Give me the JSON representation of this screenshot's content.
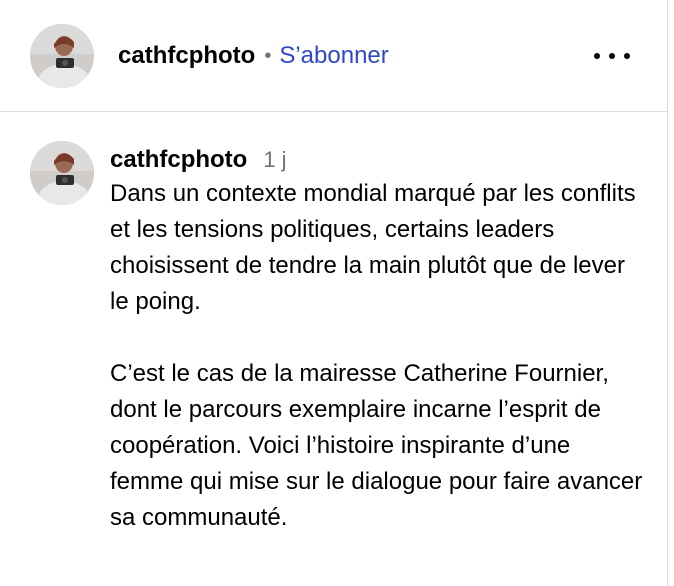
{
  "post": {
    "author": "cathfcphoto",
    "separator": "•",
    "follow_label": "S’abonner",
    "more_icon": "more-horizontal-icon"
  },
  "comment": {
    "author": "cathfcphoto",
    "time": "1 j",
    "paragraph_1": "Dans un contexte mondial marqué par les conflits et les tensions politiques, certains leaders choisissent de tendre la main plutôt que de lever le poing.",
    "paragraph_2": "C’est le cas de la mairesse Catherine Fournier, dont le parcours exemplaire incarne l’esprit de coopération. Voici l’histoire inspirante d’une femme qui mise sur le dialogue pour faire avancer sa communauté."
  },
  "colors": {
    "link": "#3048c8",
    "muted": "#737373",
    "divider": "#dbdbdb"
  }
}
